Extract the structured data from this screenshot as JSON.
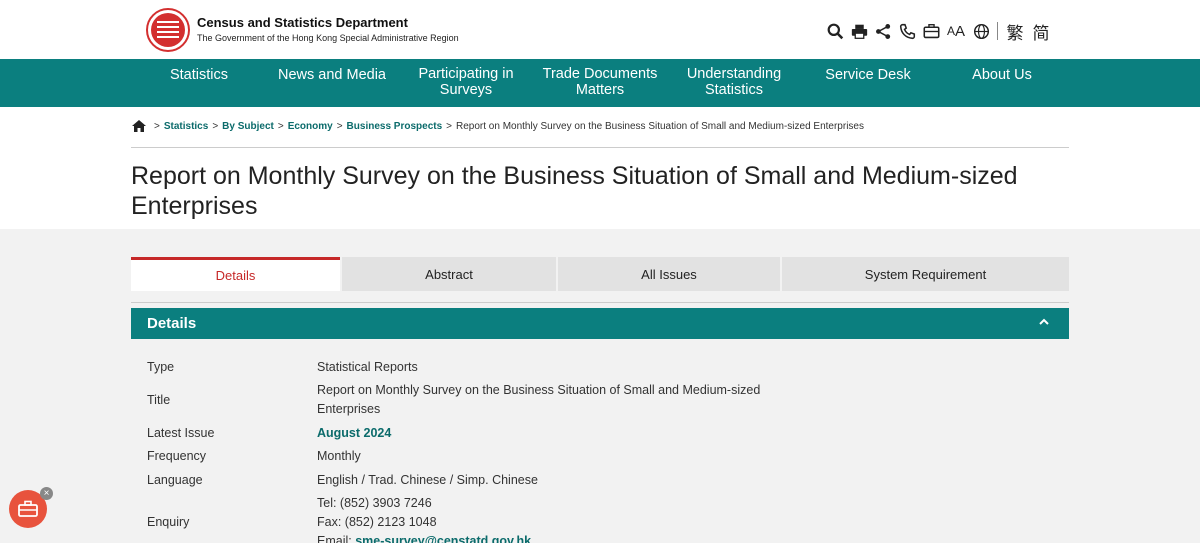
{
  "header": {
    "org_name": "Census and Statistics Department",
    "org_sub": "The Government of the Hong Kong Special Administrative Region",
    "tools": [
      "search-icon",
      "print-icon",
      "share-icon",
      "phone-icon",
      "briefcase-icon",
      "font-size-icon",
      "globe-icon"
    ],
    "font_size_label_small": "A",
    "font_size_label_large": "A",
    "lang_trad": "繁",
    "lang_simp": "简"
  },
  "nav": {
    "items": [
      {
        "label": "Statistics"
      },
      {
        "label": "News and Media"
      },
      {
        "label": "Participating in Surveys"
      },
      {
        "label": "Trade Documents Matters"
      },
      {
        "label": "Understanding Statistics"
      },
      {
        "label": "Service Desk"
      },
      {
        "label": "About Us"
      }
    ]
  },
  "breadcrumb": {
    "links": [
      "Statistics",
      "By Subject",
      "Economy",
      "Business Prospects"
    ],
    "current": "Report on Monthly Survey on the Business Situation of Small and Medium-sized Enterprises",
    "separator": ">"
  },
  "page": {
    "title": "Report on Monthly Survey on the Business Situation of Small and Medium-sized Enterprises"
  },
  "tabs": [
    {
      "label": "Details",
      "active": true
    },
    {
      "label": "Abstract",
      "active": false
    },
    {
      "label": "All Issues",
      "active": false
    },
    {
      "label": "System Requirement",
      "active": false
    }
  ],
  "details": {
    "heading": "Details",
    "rows": {
      "type": {
        "label": "Type",
        "value": "Statistical Reports"
      },
      "title": {
        "label": "Title",
        "value_line1": "Report on Monthly Survey on the Business Situation of Small and Medium-sized",
        "value_line2": "Enterprises"
      },
      "latest": {
        "label": "Latest Issue",
        "value": "August 2024"
      },
      "frequency": {
        "label": "Frequency",
        "value": "Monthly"
      },
      "language": {
        "label": "Language",
        "value": "English / Trad. Chinese / Simp. Chinese"
      },
      "enquiry": {
        "label": "Enquiry",
        "tel": "Tel: (852) 3903 7246",
        "fax": "Fax: (852) 2123 1048",
        "email_prefix": "Email: ",
        "email": "sme-survey@censtatd.gov.hk"
      }
    }
  },
  "colors": {
    "brand_teal": "#0b7f7f",
    "accent_red": "#c62828",
    "fab_orange": "#e8533d"
  }
}
